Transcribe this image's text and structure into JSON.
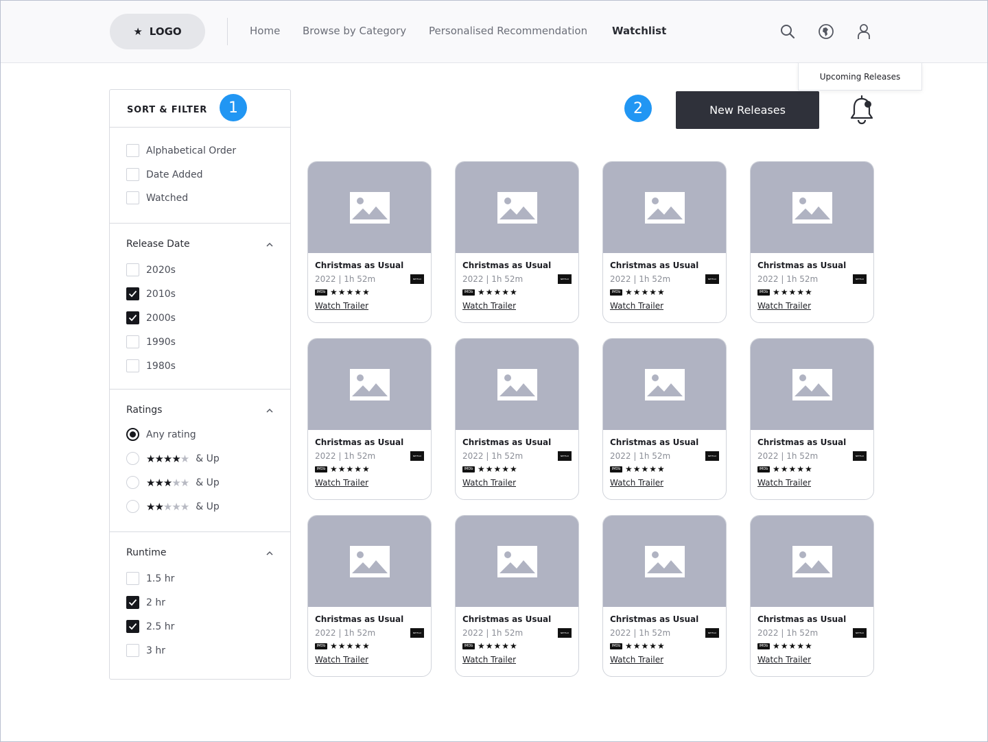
{
  "header": {
    "logo_label": "LOGO",
    "nav": [
      {
        "label": "Home",
        "active": false
      },
      {
        "label": "Browse by Category",
        "active": false
      },
      {
        "label": "Personalised Recommendation",
        "active": false
      },
      {
        "label": "Watchlist",
        "active": true
      }
    ],
    "icons": [
      "search-icon",
      "globe-icon",
      "user-icon"
    ]
  },
  "sidebar": {
    "title": "SORT & FILTER",
    "badge": "1",
    "sort_options": [
      {
        "label": "Alphabetical Order",
        "checked": false
      },
      {
        "label": "Date Added",
        "checked": false
      },
      {
        "label": "Watched",
        "checked": false
      }
    ],
    "release_date": {
      "title": "Release Date",
      "options": [
        {
          "label": "2020s",
          "checked": false
        },
        {
          "label": "2010s",
          "checked": true
        },
        {
          "label": "2000s",
          "checked": true
        },
        {
          "label": "1990s",
          "checked": false
        },
        {
          "label": "1980s",
          "checked": false
        }
      ]
    },
    "ratings": {
      "title": "Ratings",
      "any_label": "Any rating",
      "up_label": "& Up",
      "options": [
        {
          "stars": 4,
          "selected": false
        },
        {
          "stars": 3,
          "selected": false
        },
        {
          "stars": 2,
          "selected": false
        }
      ],
      "any_selected": true
    },
    "runtime": {
      "title": "Runtime",
      "options": [
        {
          "label": "1.5 hr",
          "checked": false
        },
        {
          "label": "2 hr",
          "checked": true
        },
        {
          "label": "2.5 hr",
          "checked": true
        },
        {
          "label": "3 hr",
          "checked": false
        }
      ]
    }
  },
  "actions": {
    "badge": "2",
    "new_releases_label": "New Releases",
    "tooltip": "Upcoming Releases"
  },
  "cards": [
    {
      "title": "Christmas as Usual",
      "meta": "2022 | 1h 52m",
      "link": "Watch Trailer",
      "imdb": "IMDb",
      "platform": "NETFLIX",
      "stars": 5
    },
    {
      "title": "Christmas as Usual",
      "meta": "2022 | 1h 52m",
      "link": "Watch Trailer",
      "imdb": "IMDb",
      "platform": "NETFLIX",
      "stars": 5
    },
    {
      "title": "Christmas as Usual",
      "meta": "2022 | 1h 52m",
      "link": "Watch Trailer",
      "imdb": "IMDb",
      "platform": "NETFLIX",
      "stars": 5
    },
    {
      "title": "Christmas as Usual",
      "meta": "2022 | 1h 52m",
      "link": "Watch Trailer",
      "imdb": "IMDb",
      "platform": "NETFLIX",
      "stars": 5
    },
    {
      "title": "Christmas as Usual",
      "meta": "2022 | 1h 52m",
      "link": "Watch Trailer",
      "imdb": "IMDb",
      "platform": "NETFLIX",
      "stars": 5
    },
    {
      "title": "Christmas as Usual",
      "meta": "2022 | 1h 52m",
      "link": "Watch Trailer",
      "imdb": "IMDb",
      "platform": "NETFLIX",
      "stars": 5
    },
    {
      "title": "Christmas as Usual",
      "meta": "2022 | 1h 52m",
      "link": "Watch Trailer",
      "imdb": "IMDb",
      "platform": "NETFLIX",
      "stars": 5
    },
    {
      "title": "Christmas as Usual",
      "meta": "2022 | 1h 52m",
      "link": "Watch Trailer",
      "imdb": "IMDb",
      "platform": "NETFLIX",
      "stars": 5
    },
    {
      "title": "Christmas as Usual",
      "meta": "2022 | 1h 52m",
      "link": "Watch Trailer",
      "imdb": "IMDb",
      "platform": "NETFLIX",
      "stars": 5
    },
    {
      "title": "Christmas as Usual",
      "meta": "2022 | 1h 52m",
      "link": "Watch Trailer",
      "imdb": "IMDb",
      "platform": "NETFLIX",
      "stars": 5
    },
    {
      "title": "Christmas as Usual",
      "meta": "2022 | 1h 52m",
      "link": "Watch Trailer",
      "imdb": "IMDb",
      "platform": "NETFLIX",
      "stars": 5
    },
    {
      "title": "Christmas as Usual",
      "meta": "2022 | 1h 52m",
      "link": "Watch Trailer",
      "imdb": "IMDb",
      "platform": "NETFLIX",
      "stars": 5
    }
  ],
  "colors": {
    "accent_badge": "#2196f3",
    "button_dark": "#2f313a",
    "placeholder": "#b0b3c2"
  }
}
